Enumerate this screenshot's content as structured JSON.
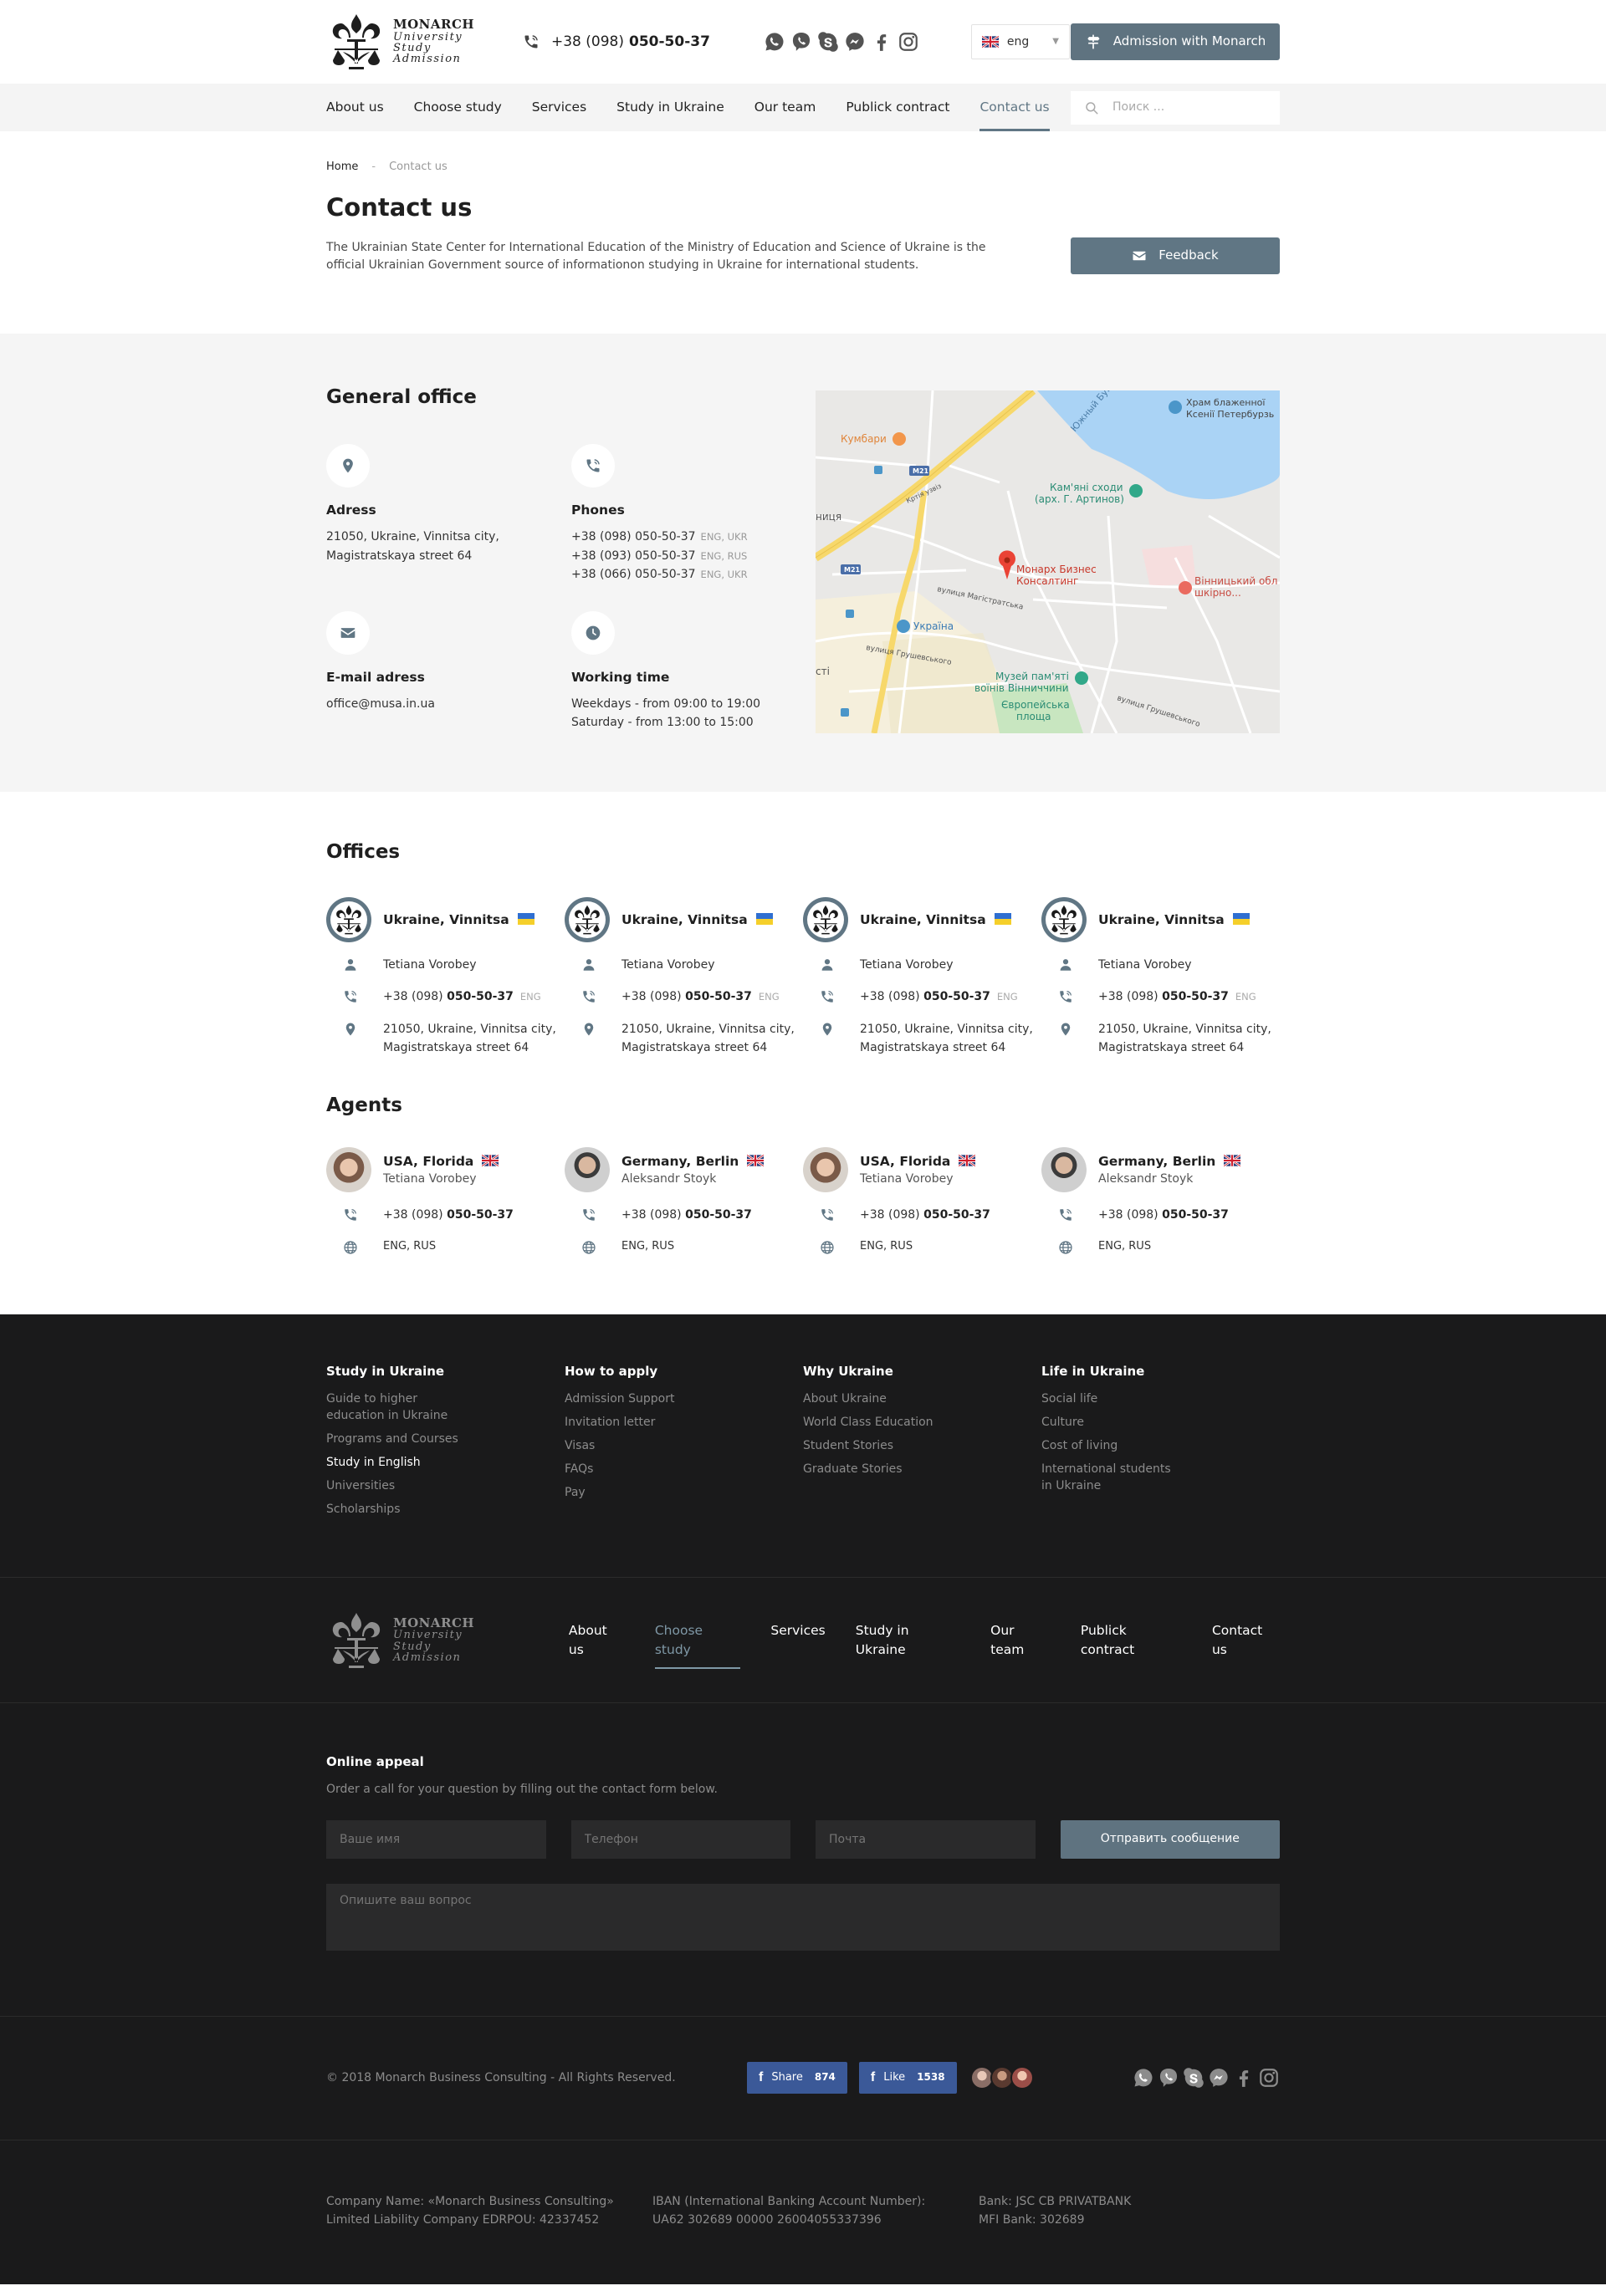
{
  "brand": {
    "logo_line1": "MONARCH",
    "logo_line2": "University",
    "logo_line3": "Study",
    "logo_line4": "Admission"
  },
  "header": {
    "phone_prefix": "+38 (098)",
    "phone_number": "050-50-37",
    "language": "eng",
    "admission_button": "Admission with Monarch"
  },
  "nav": {
    "items": [
      "About us",
      "Choose study",
      "Services",
      "Study in Ukraine",
      "Our team",
      "Publick contract",
      "Contact us"
    ],
    "active": "Contact us",
    "search_placeholder": "Поиск ..."
  },
  "breadcrumb": {
    "home": "Home",
    "separator": "-",
    "current": "Contact us"
  },
  "page": {
    "title": "Contact us",
    "intro": "The Ukrainian State Center for International Education of the Ministry of Education and Science of Ukraine is the official Ukrainian Government source of informationon studying in Ukraine for international students.",
    "feedback_button": "Feedback"
  },
  "general_office": {
    "title": "General office",
    "address": {
      "label": "Adress",
      "line1": "21050, Ukraine, Vinnitsa city,",
      "line2": "Magistratskaya street 64"
    },
    "phones": {
      "label": "Phones",
      "items": [
        {
          "number": "+38 (098) 050-50-37",
          "langs": "ENG, UKR"
        },
        {
          "number": "+38 (093) 050-50-37",
          "langs": "ENG, RUS"
        },
        {
          "number": "+38 (066) 050-50-37",
          "langs": "ENG, UKR"
        }
      ]
    },
    "email": {
      "label": "E-mail adress",
      "value": "office@musa.in.ua"
    },
    "hours": {
      "label": "Working time",
      "line1": "Weekdays - from 09:00 to 19:00",
      "line2": "Saturday - from 13:00 to 15:00"
    }
  },
  "map": {
    "labels": {
      "church": "Храм блаженної",
      "church2": "Ксенії Петербурзь",
      "bug": "Южный Буг",
      "kumbari": "Кумбари",
      "m21": "M21",
      "kartia": "Кртія узвіз",
      "stairs": "Кам'яні сходи",
      "stairs2": "(арх. Г. Артинов)",
      "nytsia": "ниця",
      "marker": "Монарх Бизнес",
      "marker2": "Консалтинг",
      "hospital": "Вінницький обл",
      "hospital2": "шкірно...",
      "magistr": "вулиця Магістратська",
      "ukraina": "Україна",
      "hrush": "вулиця Грушевського",
      "museum": "Музей пам'яті",
      "museum2": "воїнів Вінниччини",
      "square": "Європейська",
      "square2": "площа",
      "hrush2": "вулиця Грушевського",
      "sti": "сті"
    }
  },
  "offices": {
    "title": "Offices",
    "items": [
      {
        "city": "Ukraine, Vinnitsa",
        "person": "Tetiana Vorobey",
        "phone_prefix": "+38 (098)",
        "phone_number": "050-50-37",
        "lang": "ENG",
        "addr1": "21050, Ukraine, Vinnitsa city,",
        "addr2": "Magistratskaya street 64"
      },
      {
        "city": "Ukraine, Vinnitsa",
        "person": "Tetiana Vorobey",
        "phone_prefix": "+38 (098)",
        "phone_number": "050-50-37",
        "lang": "ENG",
        "addr1": "21050, Ukraine, Vinnitsa city,",
        "addr2": "Magistratskaya street 64"
      },
      {
        "city": "Ukraine, Vinnitsa",
        "person": "Tetiana Vorobey",
        "phone_prefix": "+38 (098)",
        "phone_number": "050-50-37",
        "lang": "ENG",
        "addr1": "21050, Ukraine, Vinnitsa city,",
        "addr2": "Magistratskaya street 64"
      },
      {
        "city": "Ukraine, Vinnitsa",
        "person": "Tetiana Vorobey",
        "phone_prefix": "+38 (098)",
        "phone_number": "050-50-37",
        "lang": "ENG",
        "addr1": "21050, Ukraine, Vinnitsa city,",
        "addr2": "Magistratskaya street 64"
      }
    ]
  },
  "agents": {
    "title": "Agents",
    "items": [
      {
        "location": "USA, Florida",
        "name": "Tetiana Vorobey",
        "phone_prefix": "+38 (098)",
        "phone_number": "050-50-37",
        "langs": "ENG, RUS"
      },
      {
        "location": "Germany, Berlin",
        "name": "Aleksandr Stoyk",
        "phone_prefix": "+38 (098)",
        "phone_number": "050-50-37",
        "langs": "ENG, RUS"
      },
      {
        "location": "USA, Florida",
        "name": "Tetiana Vorobey",
        "phone_prefix": "+38 (098)",
        "phone_number": "050-50-37",
        "langs": "ENG, RUS"
      },
      {
        "location": "Germany, Berlin",
        "name": "Aleksandr Stoyk",
        "phone_prefix": "+38 (098)",
        "phone_number": "050-50-37",
        "langs": "ENG, RUS"
      }
    ]
  },
  "footer": {
    "columns": [
      {
        "title": "Study in Ukraine",
        "links": [
          "Guide to higher education in Ukraine",
          "Programs and Courses",
          "Study in English",
          "Universities",
          "Scholarships"
        ],
        "active_index": 2
      },
      {
        "title": "How to apply",
        "links": [
          "Admission Support",
          "Invitation letter",
          "Visas",
          "FAQs",
          "Pay"
        ]
      },
      {
        "title": "Why Ukraine",
        "links": [
          "About Ukraine",
          "World Class Education",
          "Student Stories",
          "Graduate Stories"
        ]
      },
      {
        "title": "Life in Ukraine",
        "links": [
          "Social life",
          "Culture",
          "Cost of living",
          "International students in Ukraine"
        ]
      }
    ],
    "nav": [
      "About us",
      "Choose study",
      "Services",
      "Study in Ukraine",
      "Our team",
      "Publick contract",
      "Contact us"
    ],
    "nav_active": "Choose study",
    "appeal": {
      "title": "Online appeal",
      "subtitle": "Order a call for your question by filling out the contact form below.",
      "name_placeholder": "Ваше имя",
      "phone_placeholder": "Телефон",
      "email_placeholder": "Почта",
      "submit": "Отправить сообщение",
      "question_placeholder": "Опишите ваш вопрос"
    },
    "copyright": "© 2018 Monarch Business Consulting - All Rights Reserved.",
    "share": {
      "label": "Share",
      "count": "874"
    },
    "like": {
      "label": "Like",
      "count": "1538"
    },
    "legal": {
      "company1": "Company Name: «Monarch Business Consulting»",
      "company2": "Limited Liability Company EDRPOU: 42337452",
      "iban1": "IBAN (International Banking Account Number):",
      "iban2": "UA62 302689 00000 26004055337396",
      "bank1": "Bank: JSC CB PRIVATBANK",
      "bank2": "MFI Bank: 302689"
    }
  },
  "colors": {
    "accent": "#607684",
    "footer_bg": "#1a1a1b",
    "nav_bg": "#f4f4f4",
    "section_bg": "#f5f5f5",
    "facebook": "#3b5998"
  }
}
